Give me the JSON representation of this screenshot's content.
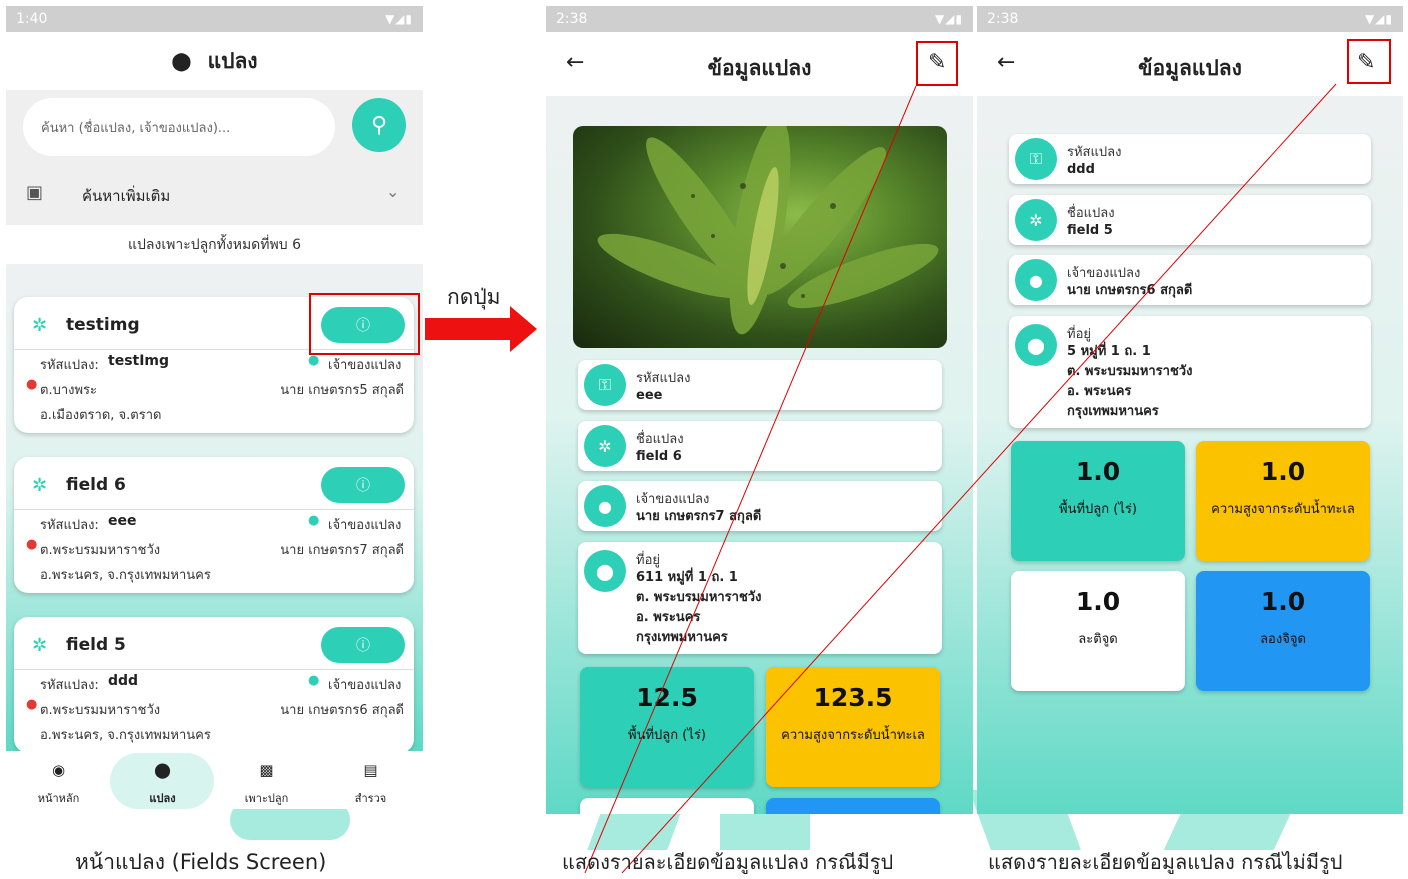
{
  "annotation": {
    "press_label": "กดปุ่ม"
  },
  "captions": {
    "left": "หน้าแปลง (Fields Screen)",
    "middle": "แสดงรายละเอียดข้อมูลแปลง กรณีมีรูป",
    "right": "แสดงรายละเอียดข้อมูลแปลง กรณีไม่มีรูป"
  },
  "screen1": {
    "status_time": "1:40",
    "title": "แปลง",
    "search_placeholder": "ค้นหา (ชื่อแปลง, เจ้าของแปลง)...",
    "more_search": "ค้นหาเพิ่มเติม",
    "count_text": "แปลงเพาะปลูกทั้งหมดที่พบ 6",
    "code_prefix": "รหัสแปลง:",
    "owner_label": "เจ้าของแปลง",
    "fields": [
      {
        "name": "testimg",
        "code": "testImg",
        "owner": "นาย เกษตรกร5 สกุลดี",
        "location1": "ต.บางพระ",
        "location2": "อ.เมืองตราด, จ.ตราด"
      },
      {
        "name": "field 6",
        "code": "eee",
        "owner": "นาย เกษตรกร7 สกุลดี",
        "location1": "ต.พระบรมมหาราชวัง",
        "location2": "อ.พระนคร, จ.กรุงเทพมหานคร"
      },
      {
        "name": "field 5",
        "code": "ddd",
        "owner": "นาย เกษตรกร6 สกุลดี",
        "location1": "ต.พระบรมมหาราชวัง",
        "location2": "อ.พระนคร, จ.กรุงเทพมหานคร"
      }
    ],
    "nav": [
      {
        "label": "หน้าหลัก",
        "icon": "target-icon"
      },
      {
        "label": "แปลง",
        "icon": "location-pin-icon"
      },
      {
        "label": "เพาะปลูก",
        "icon": "image-icon"
      },
      {
        "label": "สำรวจ",
        "icon": "document-icon"
      }
    ]
  },
  "screen2": {
    "status_time": "2:38",
    "title": "ข้อมูลแปลง",
    "photo": "cassava-leaf-photo",
    "code_label": "รหัสแปลง",
    "code": "eee",
    "name_label": "ชื่อแปลง",
    "name": "field 6",
    "owner_label": "เจ้าของแปลง",
    "owner": "นาย เกษตรกร7 สกุลดี",
    "address_label": "ที่อยู่",
    "address": [
      "611 หมู่ที่ 1 ถ. 1",
      "ต. พระบรมมหาราชวัง",
      "อ. พระนคร",
      "กรุงเทพมหานคร"
    ],
    "area_value": "12.5",
    "area_label": "พื้นที่ปลูก (ไร่)",
    "altitude_value": "123.5",
    "altitude_label": "ความสูงจากระดับน้ำทะเล"
  },
  "screen3": {
    "status_time": "2:38",
    "title": "ข้อมูลแปลง",
    "code_label": "รหัสแปลง",
    "code": "ddd",
    "name_label": "ชื่อแปลง",
    "name": "field 5",
    "owner_label": "เจ้าของแปลง",
    "owner": "นาย เกษตรกร6 สกุลดี",
    "address_label": "ที่อยู่",
    "address": [
      "5 หมู่ที่ 1 ถ. 1",
      "ต. พระบรมมหาราชวัง",
      "อ. พระนคร",
      "กรุงเทพมหานคร"
    ],
    "area_value": "1.0",
    "area_label": "พื้นที่ปลูก (ไร่)",
    "altitude_value": "1.0",
    "altitude_label": "ความสูงจากระดับน้ำทะเล",
    "lat_value": "1.0",
    "lat_label": "ละติจูด",
    "lng_value": "1.0",
    "lng_label": "ลองจิจูด"
  },
  "colors": {
    "teal": "#2dcfb6",
    "yellow": "#fbc200",
    "blue": "#2196f3",
    "highlight_red": "#e00000"
  }
}
